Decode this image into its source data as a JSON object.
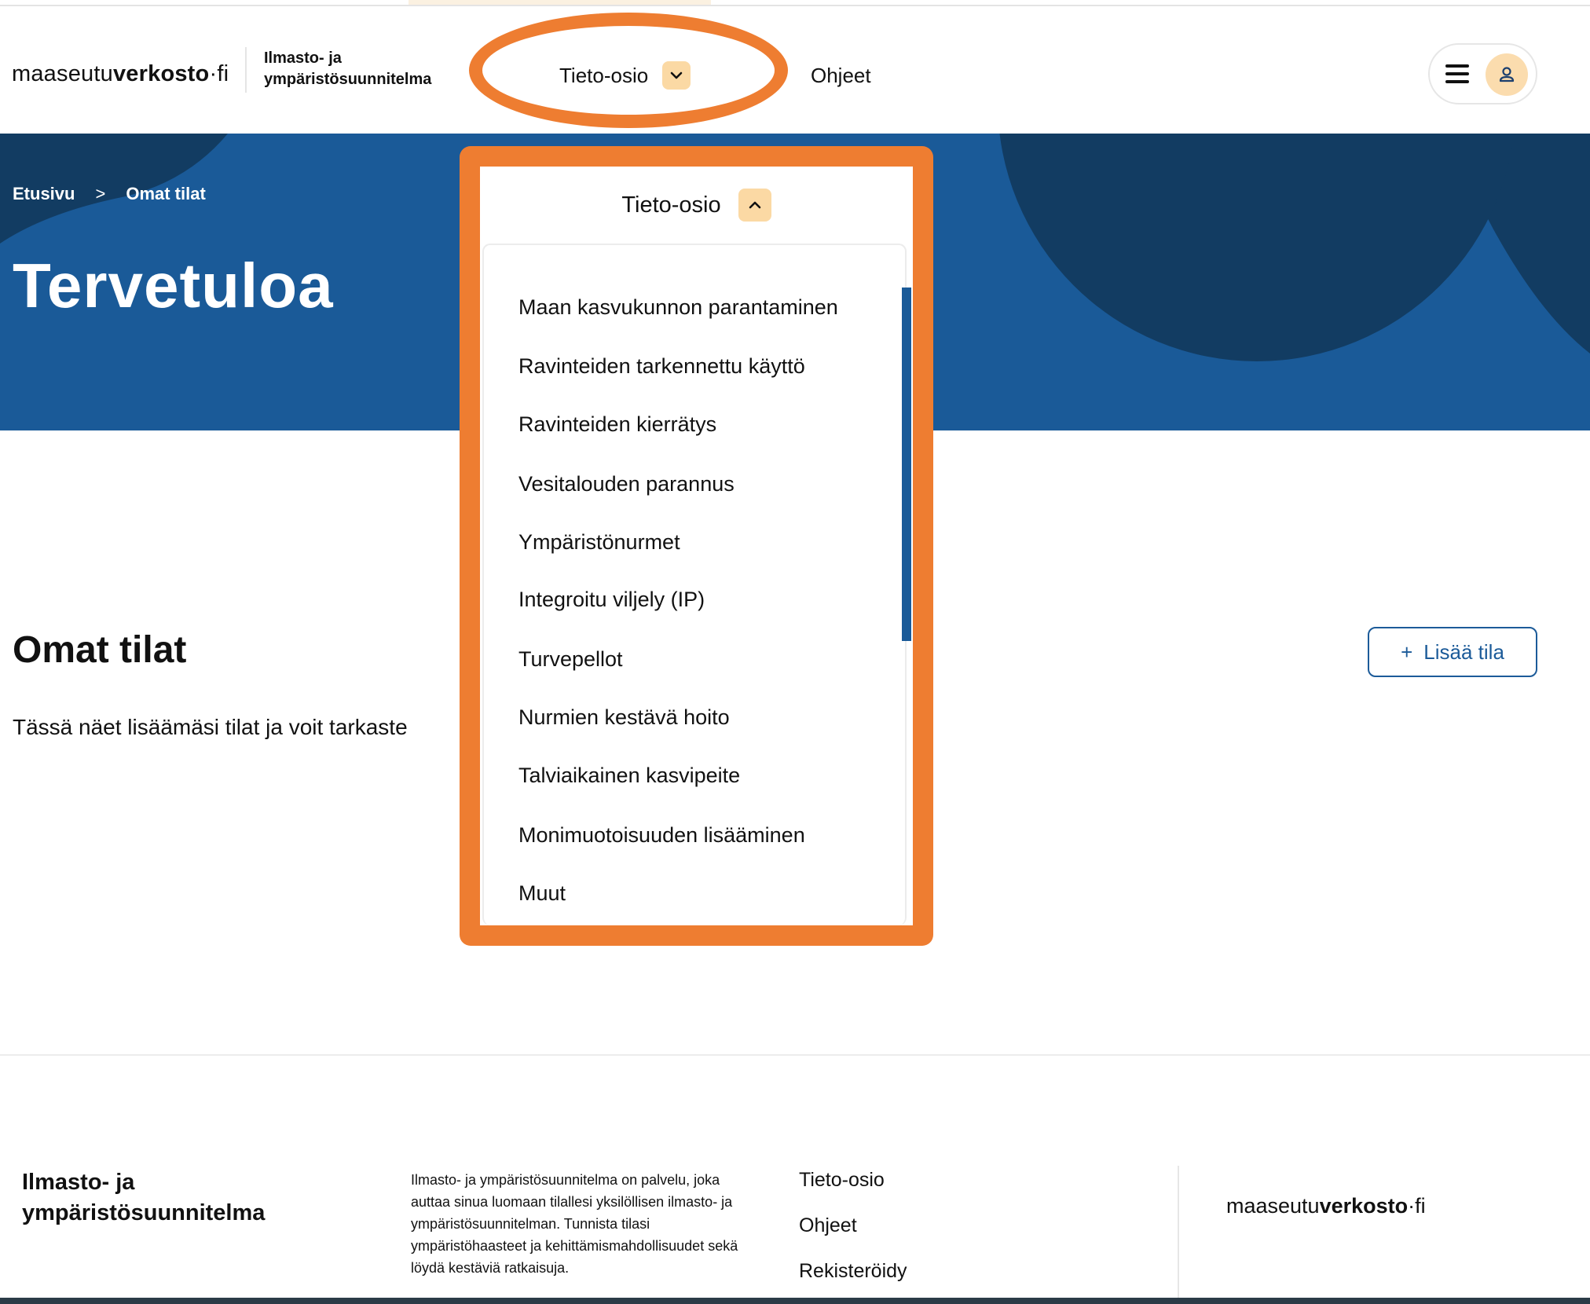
{
  "header": {
    "logo_prefix": "maaseutu",
    "logo_bold": "verkosto",
    "logo_suffix": "·fi",
    "service_line1": "Ilmasto- ja",
    "service_line2": "ympäristösuunnitelma",
    "nav": {
      "tieto_label": "Tieto-osio",
      "ohjeet_label": "Ohjeet"
    },
    "icons": {
      "menu": "hamburger-menu-icon",
      "user": "user-icon",
      "chevron_down": "chevron-down-icon"
    }
  },
  "hero": {
    "breadcrumb": [
      "Etusivu",
      "Omat tilat"
    ],
    "breadcrumb_separator": ">",
    "title": "Tervetuloa"
  },
  "main": {
    "title": "Omat tilat",
    "description": "Tässä näet lisäämäsi tilat ja voit tarkaste",
    "add_button": {
      "icon": "+",
      "label": "Lisää tila"
    }
  },
  "dropdown": {
    "label": "Tieto-osio",
    "icon": "chevron-up-icon",
    "items": [
      "Maan kasvukunnon parantaminen",
      "Ravinteiden tarkennettu käyttö",
      "Ravinteiden kierrätys",
      "Vesitalouden parannus",
      "Ympäristönurmet",
      "Integroitu viljely (IP)",
      "Turvepellot",
      "Nurmien kestävä hoito",
      "Talviaikainen kasvipeite",
      "Monimuotoisuuden lisääminen",
      "Muut"
    ]
  },
  "footer": {
    "title_line1": "Ilmasto- ja",
    "title_line2": "ympäristösuunnitelma",
    "description": "Ilmasto- ja ympäristösuunnitelma on palvelu, joka auttaa sinua luomaan tilallesi yksilöllisen ilmasto- ja ympäristösuunnitelman. Tunnista tilasi ympäristöhaasteet ja kehittämismahdollisuudet sekä löydä kestäviä ratkaisuja.",
    "links": [
      "Tieto-osio",
      "Ohjeet",
      "Rekisteröidy"
    ],
    "logo_prefix": "maaseutu",
    "logo_bold": "verkosto",
    "logo_suffix": "·fi"
  },
  "colors": {
    "brand_blue": "#1a5a98",
    "dark_blue": "#123c62",
    "accent_peach": "#fbd9a4",
    "highlight_orange": "#ee7d31"
  }
}
